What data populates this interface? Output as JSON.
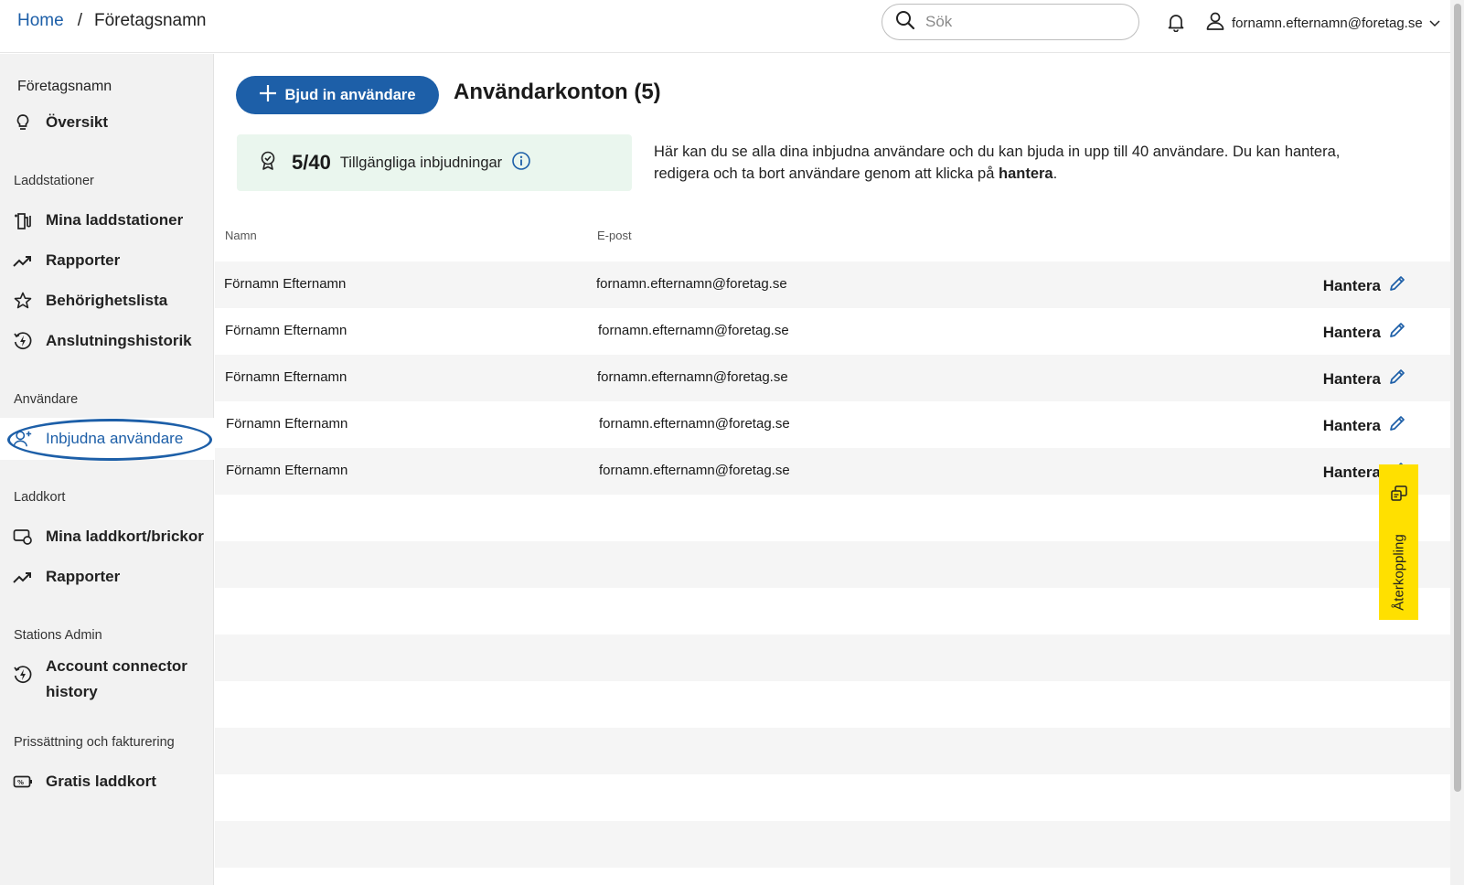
{
  "header": {
    "breadcrumb_home": "Home",
    "breadcrumb_sep": "/",
    "breadcrumb_company": "Företagsnamn",
    "search_placeholder": "Sök",
    "user_email": "fornamn.efternamn@foretag.se"
  },
  "sidebar": {
    "company": "Företagsnamn",
    "overview": "Översikt",
    "sections": {
      "charging": "Laddstationer",
      "users": "Användare",
      "cards": "Laddkort",
      "stations_admin": "Stations Admin",
      "pricing": "Prissättning och fakturering"
    },
    "items": {
      "my_stations": "Mina laddstationer",
      "reports": "Rapporter",
      "permissions": "Behörighetslista",
      "connection_history": "Anslutningshistorik",
      "invited_users": "Inbjudna användare",
      "my_cards": "Mina laddkort/brickor",
      "card_reports": "Rapporter",
      "account_connector_history": "Account connector history",
      "free_card": "Gratis laddkort"
    }
  },
  "main": {
    "invite_button": "Bjud in användare",
    "title": "Användarkonton (5)",
    "stat_value": "5/40",
    "stat_label": "Tillgängliga inbjudningar",
    "desc_text": "Här kan du se alla dina inbjudna användare och du kan bjuda in upp till 40 användare. Du kan hantera, redigera och ta bort användare genom att klicka på ",
    "desc_bold": "hantera",
    "desc_end": ".",
    "col_name": "Namn",
    "col_email": "E-post",
    "manage_label": "Hantera",
    "users": [
      {
        "name": "Förnamn Efternamn",
        "email": "fornamn.efternamn@foretag.se"
      },
      {
        "name": "Förnamn Efternamn",
        "email": "fornamn.efternamn@foretag.se"
      },
      {
        "name": "Förnamn Efternamn",
        "email": "fornamn.efternamn@foretag.se"
      },
      {
        "name": "Förnamn Efternamn",
        "email": "fornamn.efternamn@foretag.se"
      },
      {
        "name": "Förnamn Efternamn",
        "email": "fornamn.efternamn@foretag.se"
      }
    ]
  },
  "feedback": {
    "label": "Återkoppling"
  },
  "colors": {
    "accent": "#1d5fa8",
    "feedback": "#ffe000",
    "stat_bg": "#eaf6ee"
  }
}
